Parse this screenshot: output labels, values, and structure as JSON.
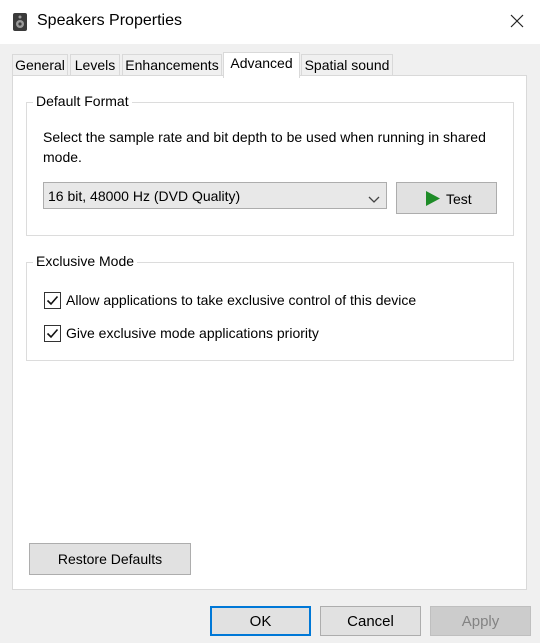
{
  "window": {
    "title": "Speakers Properties",
    "icon": "speaker-icon",
    "close_icon": "close-icon"
  },
  "tabs": [
    {
      "label": "General",
      "active": false
    },
    {
      "label": "Levels",
      "active": false
    },
    {
      "label": "Enhancements",
      "active": false
    },
    {
      "label": "Advanced",
      "active": true
    },
    {
      "label": "Spatial sound",
      "active": false
    }
  ],
  "default_format": {
    "heading": "Default Format",
    "description": "Select the sample rate and bit depth to be used when running in shared mode.",
    "selected_format": "16 bit, 48000 Hz (DVD Quality)",
    "test_label": "Test",
    "test_icon": "play-icon",
    "play_icon_color": "#1e8c28"
  },
  "exclusive_mode": {
    "heading": "Exclusive Mode",
    "options": [
      {
        "label": "Allow applications to take exclusive control of this device",
        "checked": true
      },
      {
        "label": "Give exclusive mode applications priority",
        "checked": true
      }
    ]
  },
  "restore_defaults_label": "Restore Defaults",
  "footer": {
    "ok_label": "OK",
    "cancel_label": "Cancel",
    "apply_label": "Apply",
    "apply_enabled": false
  },
  "colors": {
    "focus_border": "#0078d7"
  }
}
